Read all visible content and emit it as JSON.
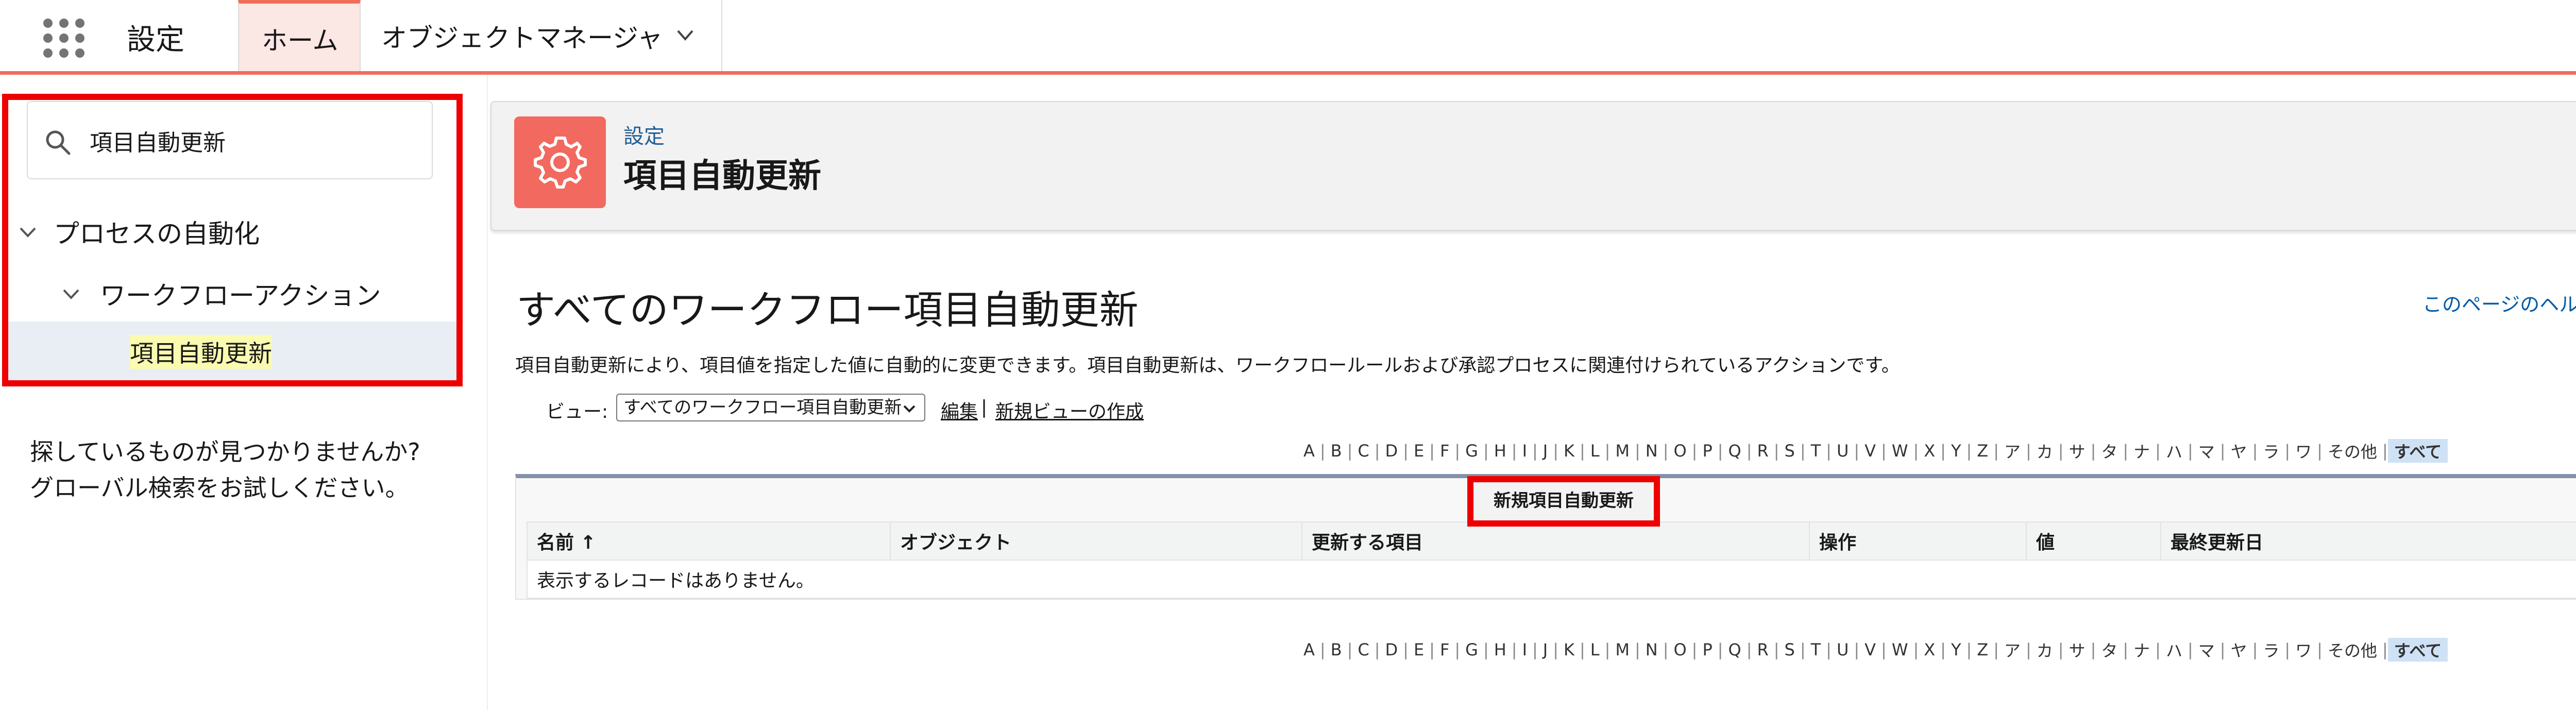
{
  "app": {
    "title": "設定"
  },
  "tabs": [
    {
      "label": "ホーム"
    },
    {
      "label": "オブジェクトマネージャ"
    }
  ],
  "sidebar": {
    "search_value": "項目自動更新",
    "tree": [
      {
        "label": "プロセスの自動化"
      },
      {
        "label": "ワークフローアクション"
      },
      {
        "label": "項目自動更新"
      }
    ],
    "not_found_line1": "探しているものが見つかりませんか?",
    "not_found_line2": "グローバル検索をお試しください。"
  },
  "header": {
    "breadcrumb": "設定",
    "title": "項目自動更新"
  },
  "main": {
    "title": "すべてのワークフロー項目自動更新",
    "help_link": "このページのヘルプ",
    "description": "項目自動更新により、項目値を指定した値に自動的に変更できます。項目自動更新は、ワークフロールールおよび承認プロセスに関連付けられているアクションです。",
    "view_label": "ビュー:",
    "view_selected": "すべてのワークフロー項目自動更新",
    "edit_link": "編集",
    "separator": "|",
    "new_view_link": "新規ビューの作成",
    "new_button": "新規項目自動更新",
    "table": {
      "columns": [
        "名前 ↑",
        "オブジェクト",
        "更新する項目",
        "操作",
        "値",
        "最終更新日"
      ],
      "empty_message": "表示するレコードはありません。"
    }
  },
  "alphabet": [
    "A",
    "B",
    "C",
    "D",
    "E",
    "F",
    "G",
    "H",
    "I",
    "J",
    "K",
    "L",
    "M",
    "N",
    "O",
    "P",
    "Q",
    "R",
    "S",
    "T",
    "U",
    "V",
    "W",
    "X",
    "Y",
    "Z",
    "ア",
    "カ",
    "サ",
    "タ",
    "ナ",
    "ハ",
    "マ",
    "ヤ",
    "ラ",
    "ワ",
    "その他",
    "すべて"
  ],
  "colors": {
    "accent": "#ef6e5b",
    "icon_bg": "#f2695f",
    "link": "#015ba7",
    "annotation": "#ee0000"
  }
}
